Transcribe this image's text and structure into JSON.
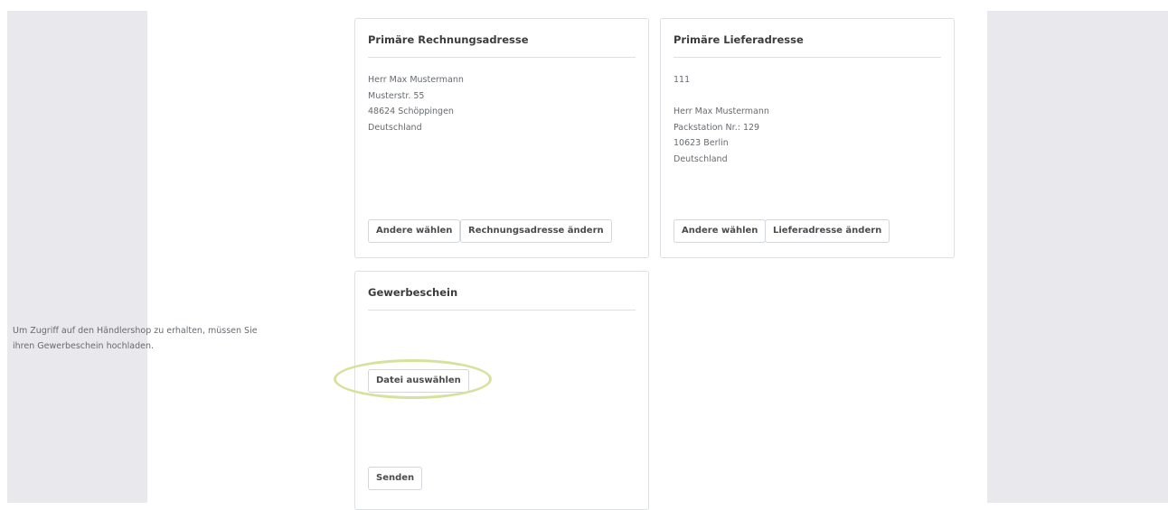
{
  "billing": {
    "title": "Primäre Rechnungsadresse",
    "lines": [
      "Herr Max Mustermann",
      "Musterstr. 55",
      "48624 Schöppingen",
      "Deutschland"
    ],
    "choose_label": "Andere wählen",
    "change_label": "Rechnungsadresse ändern"
  },
  "shipping": {
    "title": "Primäre Lieferadresse",
    "company": "111",
    "lines": [
      "Herr Max Mustermann",
      "Packstation Nr.: 129",
      "10623 Berlin",
      "Deutschland"
    ],
    "choose_label": "Andere wählen",
    "change_label": "Lieferadresse ändern"
  },
  "license": {
    "title": "Gewerbeschein",
    "text": "Um Zugriff auf den Händlershop zu erhalten, müssen Sie ihren Gewerbeschein hochladen.",
    "file_label": "Datei auswählen",
    "send_label": "Senden"
  },
  "colors": {
    "highlight": "#d6e29c",
    "gutter": "#e9e9ed",
    "border": "#dcdfe3"
  }
}
